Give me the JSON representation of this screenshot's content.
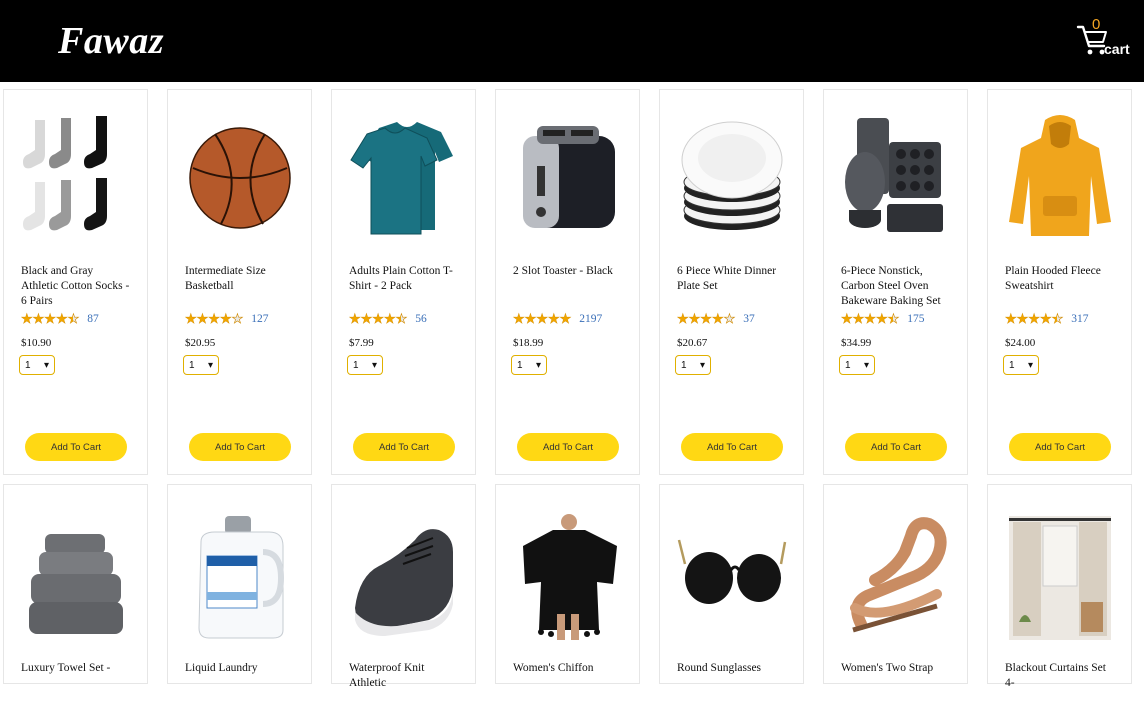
{
  "header": {
    "brand": "Fawaz",
    "cart_count": "0",
    "cart_label": "cart"
  },
  "add_to_cart_label": "Add To Cart",
  "colors": {
    "header_bg": "#000000",
    "button_bg": "#ffd814",
    "star": "#f0a500",
    "rating_count": "#3a6fb8"
  },
  "products_row1": [
    {
      "name": "Black and Gray Athletic Cotton Socks - 6 Pairs",
      "rating": 4.5,
      "rating_count": "87",
      "price": "$10.90",
      "qty": "1",
      "image": "socks"
    },
    {
      "name": "Intermediate Size Basketball",
      "rating": 4,
      "rating_count": "127",
      "price": "$20.95",
      "qty": "1",
      "image": "basketball"
    },
    {
      "name": "Adults Plain Cotton T-Shirt - 2 Pack",
      "rating": 4.5,
      "rating_count": "56",
      "price": "$7.99",
      "qty": "1",
      "image": "tshirt"
    },
    {
      "name": "2 Slot Toaster - Black",
      "rating": 5,
      "rating_count": "2197",
      "price": "$18.99",
      "qty": "1",
      "image": "toaster"
    },
    {
      "name": "6 Piece White Dinner Plate Set",
      "rating": 4,
      "rating_count": "37",
      "price": "$20.67",
      "qty": "1",
      "image": "plates"
    },
    {
      "name": "6-Piece Nonstick, Carbon Steel Oven Bakeware Baking Set",
      "rating": 4.5,
      "rating_count": "175",
      "price": "$34.99",
      "qty": "1",
      "image": "bakeware"
    },
    {
      "name": "Plain Hooded Fleece Sweatshirt",
      "rating": 4.5,
      "rating_count": "317",
      "price": "$24.00",
      "qty": "1",
      "image": "hoodie"
    }
  ],
  "products_row2": [
    {
      "name": "Luxury Towel Set -",
      "image": "towels"
    },
    {
      "name": "Liquid Laundry",
      "image": "detergent"
    },
    {
      "name": "Waterproof Knit Athletic",
      "image": "shoe"
    },
    {
      "name": "Women's Chiffon",
      "image": "cover-up"
    },
    {
      "name": "Round Sunglasses",
      "image": "sunglasses"
    },
    {
      "name": "Women's Two Strap",
      "image": "sandal"
    },
    {
      "name": "Blackout Curtains Set 4-",
      "image": "curtains"
    }
  ]
}
